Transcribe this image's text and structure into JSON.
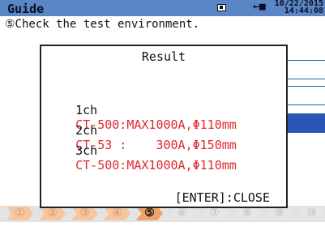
{
  "titlebar": {
    "title": "Guide",
    "plug_icon": "←■",
    "date_line1": "10/22/2015",
    "date_line2": "14:44:08"
  },
  "instruction": "⑤Check the test environment.",
  "steps": [
    {
      "label": "①",
      "state": "done"
    },
    {
      "label": "②",
      "state": "done"
    },
    {
      "label": "③",
      "state": "done"
    },
    {
      "label": "④",
      "state": "done"
    },
    {
      "label": "⑤",
      "state": "active"
    },
    {
      "label": "⑥",
      "state": "todo"
    },
    {
      "label": "⑦",
      "state": "todo"
    },
    {
      "label": "⑧",
      "state": "todo"
    },
    {
      "label": "⑨",
      "state": "todo"
    },
    {
      "label": "⑩",
      "state": "todo"
    }
  ],
  "dialog": {
    "title": "Result",
    "rows": [
      {
        "channel": "1ch",
        "value": "CT-500:MAX1000A,Φ110mm"
      },
      {
        "channel": "2ch",
        "value": "CT-53 :    300A,Φ150mm"
      },
      {
        "channel": "3ch",
        "value": "CT-500:MAX1000A,Φ110mm"
      }
    ],
    "close_hint": "[ENTER]:CLOSE"
  },
  "colors": {
    "header": "#5a86c5",
    "accent_blue": "#2a55b6",
    "value_red": "#e1282d",
    "step_active": "#f0a26c"
  }
}
